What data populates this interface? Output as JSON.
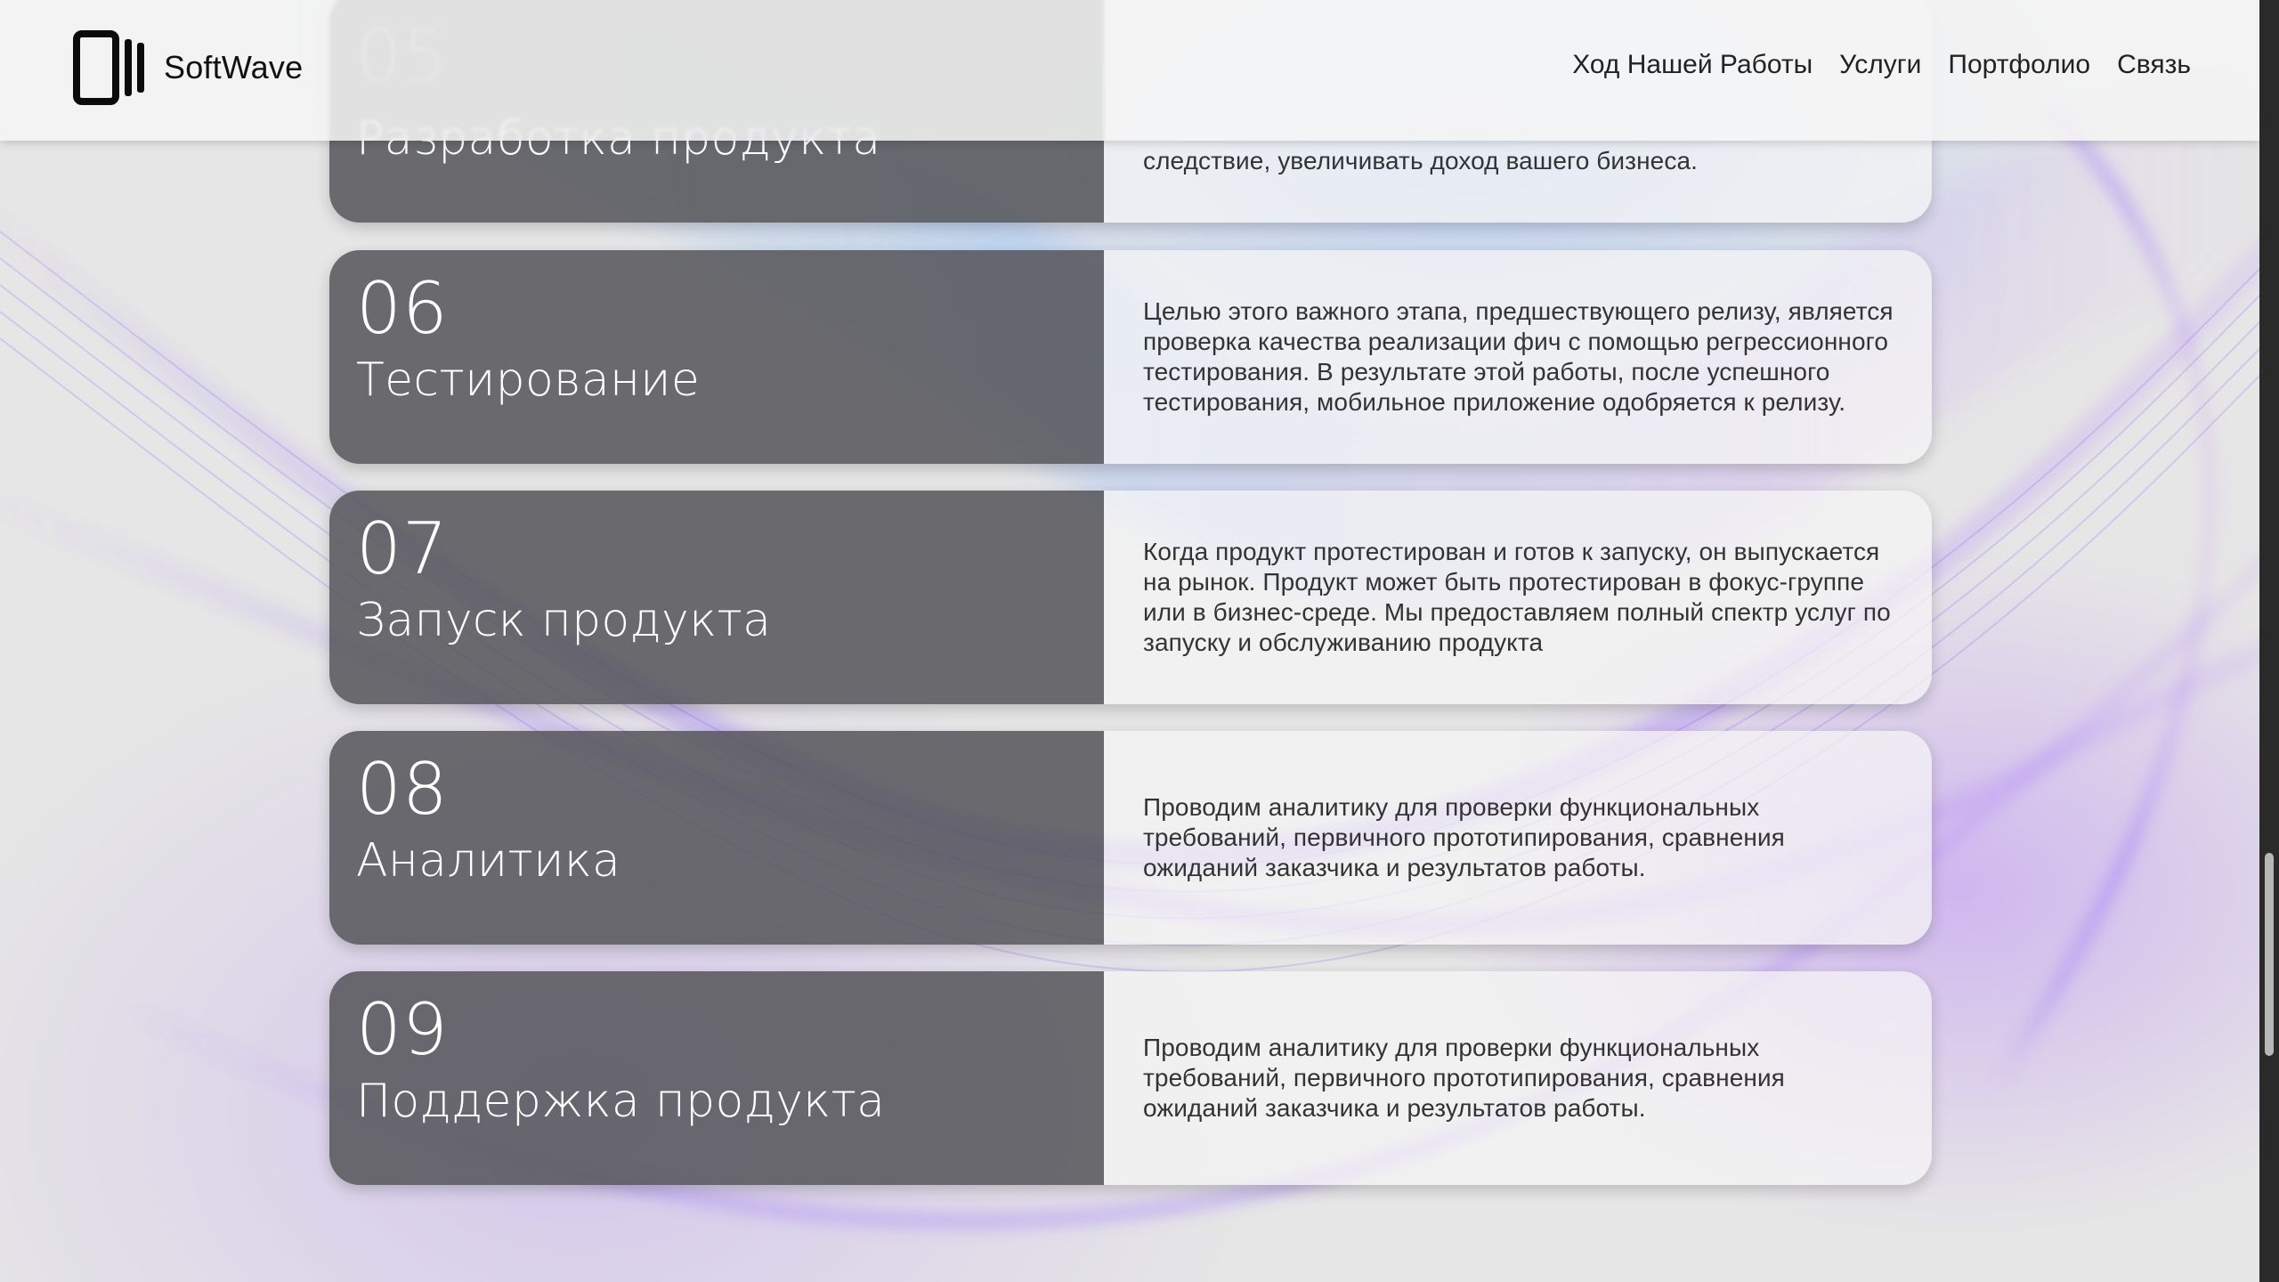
{
  "header": {
    "brand": "SoftWave",
    "nav": [
      {
        "label": "Ход Нашей Работы"
      },
      {
        "label": "Услуги"
      },
      {
        "label": "Портфолио"
      },
      {
        "label": "Связь"
      }
    ]
  },
  "steps": [
    {
      "number": "05",
      "title": "Разработка продукта",
      "description": "следствие, увеличивать доход вашего бизнеса."
    },
    {
      "number": "06",
      "title": "Тестирование",
      "description": "Целью этого важного этапа, предшествующего релизу, является проверка качества реализации фич с помощью регрессионного тестирования. В результате этой работы, после успешного тестирования, мобильное приложение одобряется к релизу."
    },
    {
      "number": "07",
      "title": "Запуск продукта",
      "description": "Когда продукт протестирован и готов к запуску, он выпускается на рынок. Продукт может быть протестирован в фокус-группе или в бизнес-среде. Мы предоставляем полный спектр услуг по запуску и обслуживанию продукта"
    },
    {
      "number": "08",
      "title": "Аналитика",
      "description": "Проводим аналитику для проверки функциональных требований, первичного прототипирования, сравнения ожиданий заказчика и результатов работы."
    },
    {
      "number": "09",
      "title": "Поддержка продукта",
      "description": "Проводим аналитику для проверки функциональных требований, первичного прототипирования, сравнения ожиданий заказчика и результатов работы."
    }
  ],
  "colors": {
    "page_bg": "#e6e6e6",
    "header_bg": "#f5f5f5",
    "card_dark": "#55555a",
    "card_light": "#f5f5f5",
    "accent_purple": "#a55fff",
    "accent_blue": "#87b4ff"
  },
  "icons": {
    "brand": "device-stack-icon"
  }
}
